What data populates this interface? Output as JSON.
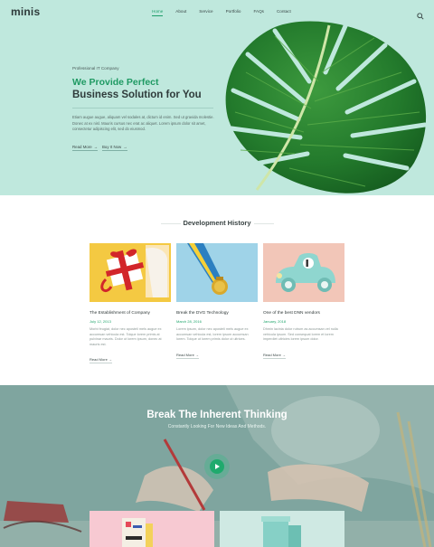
{
  "header": {
    "logo": "minis",
    "nav": [
      "Home",
      "About",
      "Service",
      "Portfolio",
      "FAQs",
      "Contact"
    ],
    "active_nav": "Home",
    "search_icon": "search-icon"
  },
  "hero": {
    "eyebrow": "Professional IT Company",
    "headline_green": "We Provide Perfect",
    "headline_dark": "Business Solution for You",
    "description": "Etiam augue augue, aliquam vel sodales at, dictum id enim. Sed ut gravida molestie. Donec at ex nisl. Mauris cursus nec erat ac aliquet. Lorem ipsum dolor sit amet, consectetur adipiscing elit, sed do eiusmod.",
    "link_1": "Read More",
    "link_2": "Buy It Now",
    "colors": {
      "background": "#bfe8dd",
      "accent": "#1f9a63"
    }
  },
  "history": {
    "title_plain": "Development",
    "title_bold": "History",
    "cards": [
      {
        "title": "The Establishment of Company",
        "date": "July 12, 2013",
        "text": "Morbi feugiat, dolor nec aposteli mels augue ex accumsan vehicula est. Tolque lorem primis at pulvinar mauris. Dolor ut lorem ipsum, donec at mauris est.",
        "link": "Read More",
        "image": "gift-box-image"
      },
      {
        "title": "Break the DVG Technology",
        "date": "March 28, 2016",
        "text": "Lorem ipsum, dolor nec aposteli mels augue ex accumsan vehicula est, lorem ipsum accumsan lorem. Tolque ut lorem primis dolor ut ultrices.",
        "link": "Read More",
        "image": "medal-image"
      },
      {
        "title": "One of the best DNN vendors",
        "date": "January, 2018",
        "text": "Dhmin lacinia dolor rutrum as accumsan vel nulla vehicula ipsum. Sed consequat lorem et lorem imperdiet ultricies lorem ipsum dolor.",
        "link": "Read More",
        "image": "toy-car-image"
      }
    ]
  },
  "break_section": {
    "title": "Break The Inherent Thinking",
    "subtitle": "Constantly Looking For New Ideas And Methods.",
    "play_icon": "play-icon",
    "colors": {
      "overlay": "#7fa59f",
      "play": "#1faa6d"
    }
  }
}
